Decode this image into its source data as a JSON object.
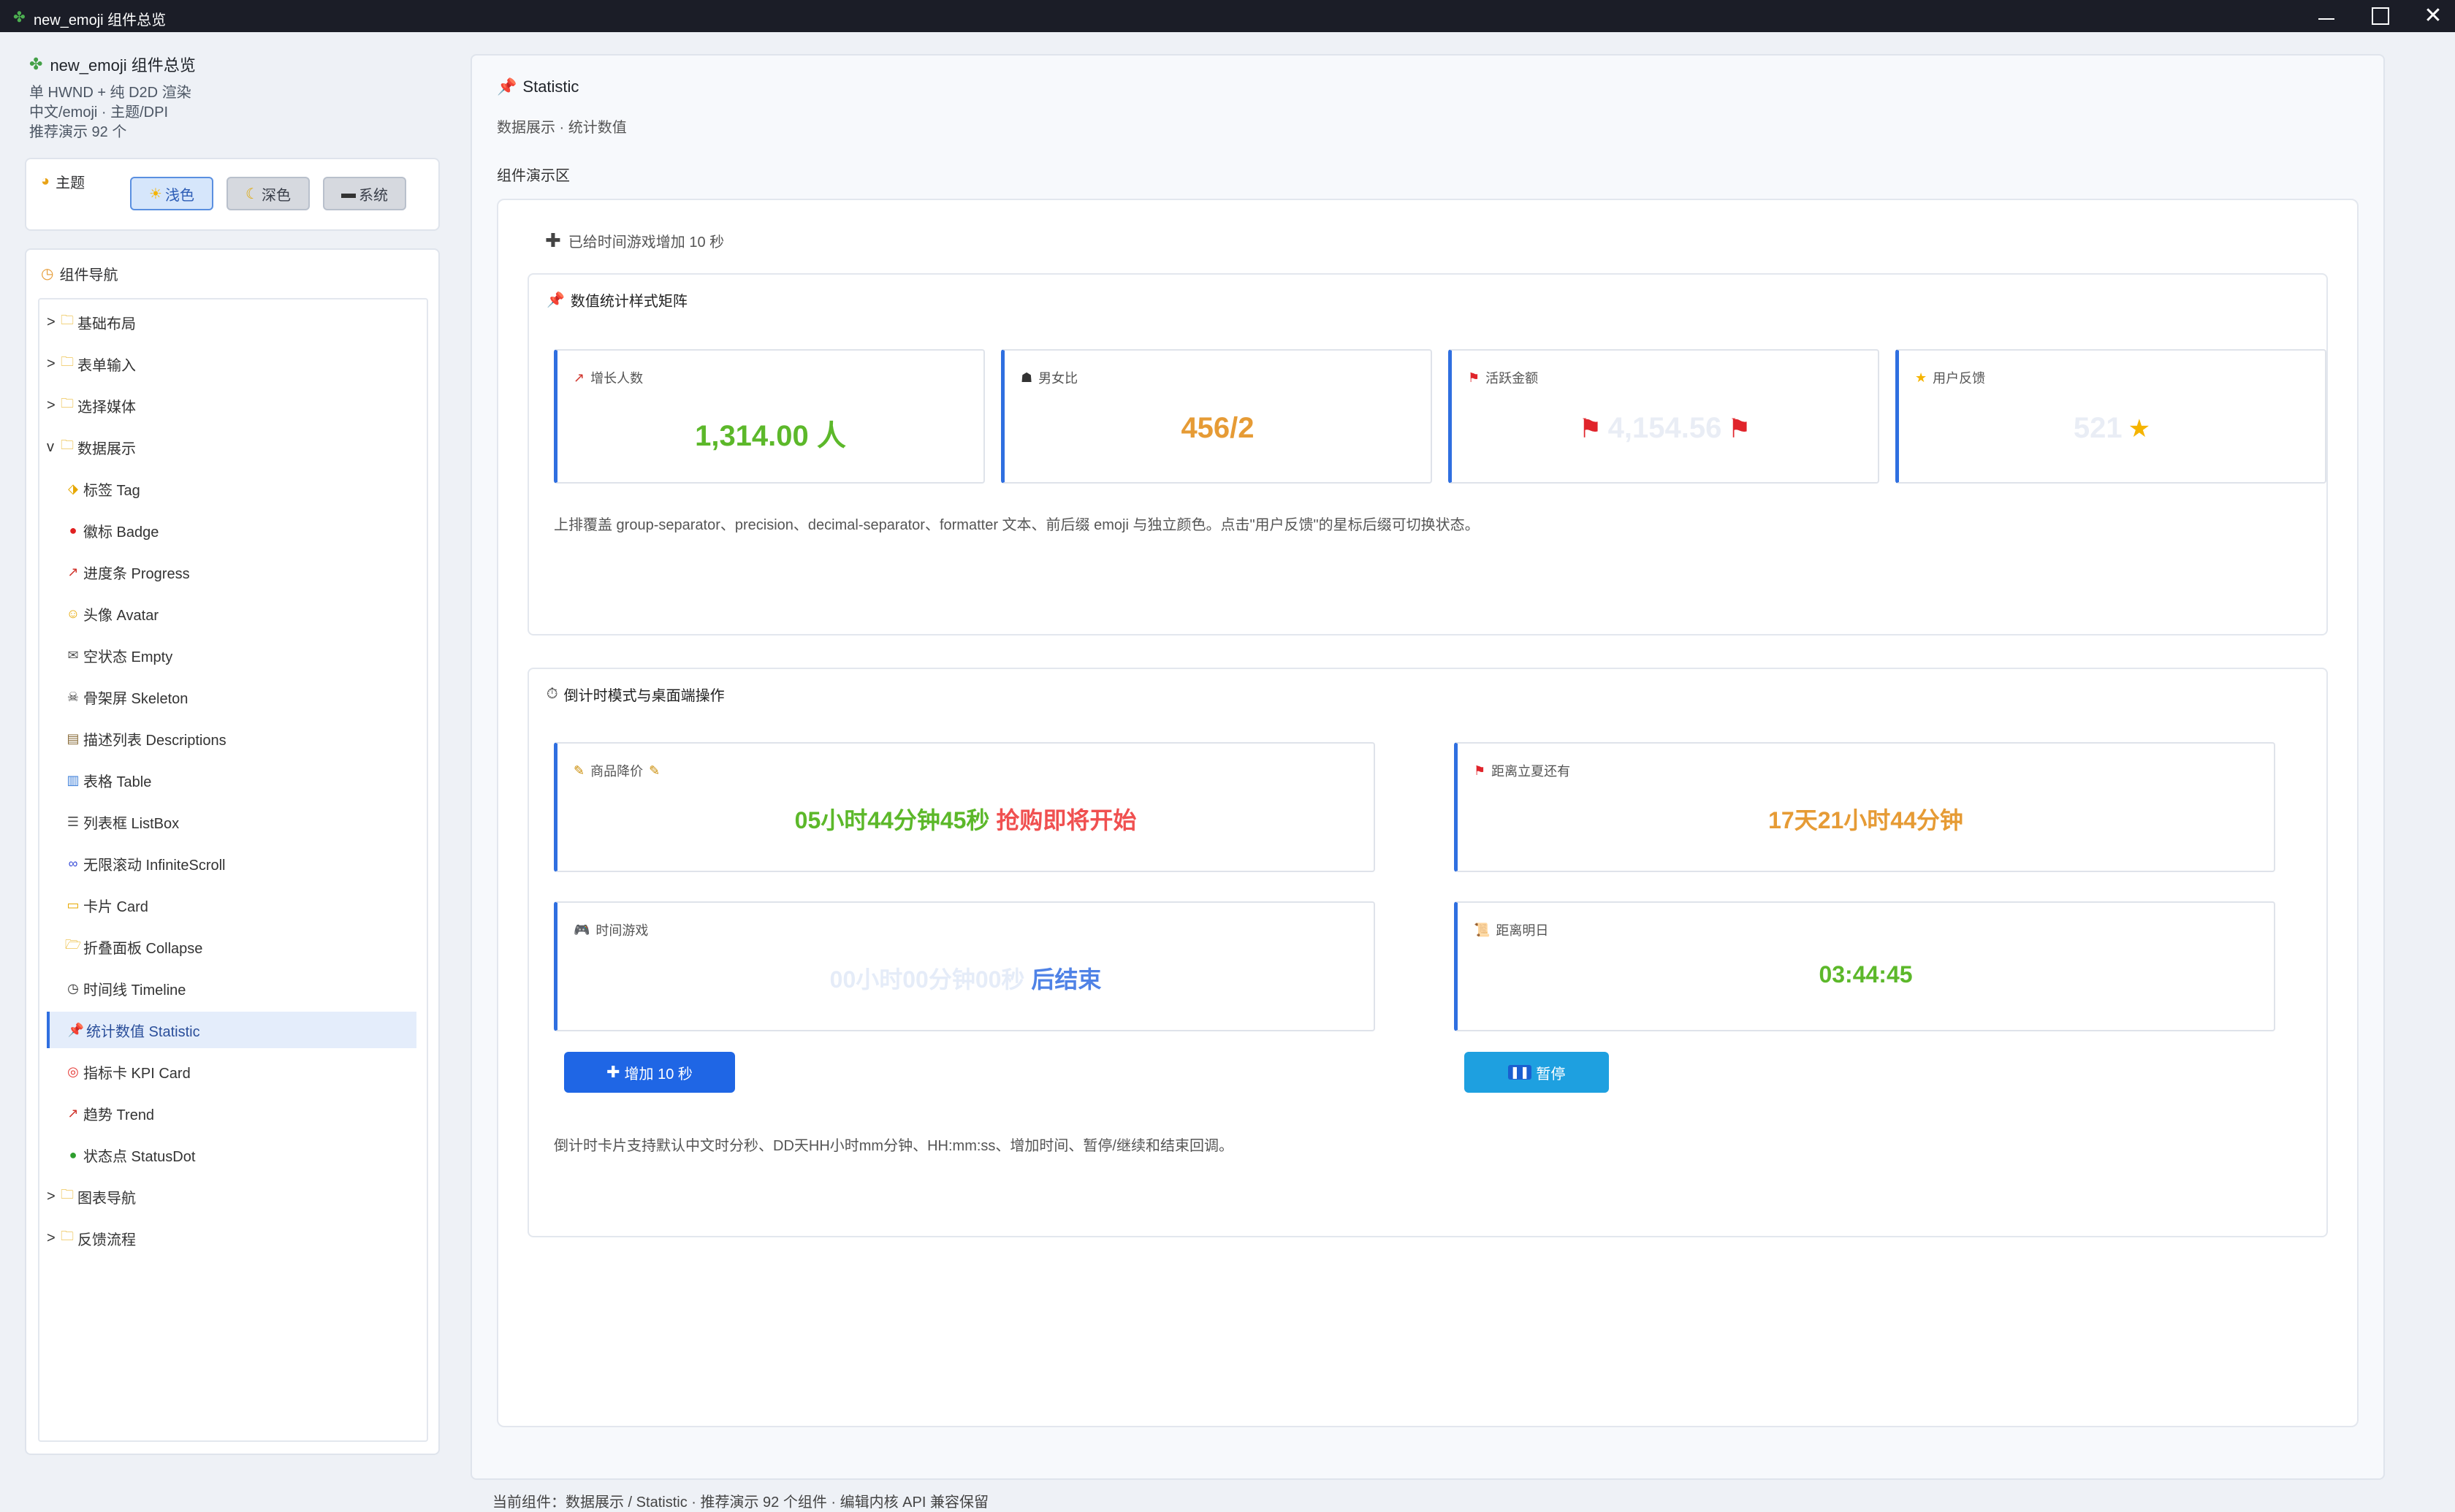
{
  "window": {
    "title": "new_emoji 组件总览",
    "app_icon": "clover-icon"
  },
  "sidebar": {
    "app_name": "new_emoji 组件总览",
    "info_lines": [
      "单 HWND + 纯 D2D 渲染",
      "中文/emoji · 主题/DPI",
      "推荐演示 92 个"
    ],
    "theme": {
      "label": "主题",
      "buttons": [
        {
          "label": "浅色",
          "icon": "sun-icon",
          "active": true
        },
        {
          "label": "深色",
          "icon": "moon-icon",
          "active": false
        },
        {
          "label": "系统",
          "icon": "laptop-icon",
          "active": false
        }
      ]
    },
    "nav": {
      "label": "组件导航",
      "items": [
        {
          "label": "基础布局",
          "arrow": ">",
          "icon": "folder-icon",
          "level": 0
        },
        {
          "label": "表单输入",
          "arrow": ">",
          "icon": "folder-icon",
          "level": 0
        },
        {
          "label": "选择媒体",
          "arrow": ">",
          "icon": "folder-icon",
          "level": 0
        },
        {
          "label": "数据展示",
          "arrow": "v",
          "icon": "folder-icon",
          "level": 0
        },
        {
          "label": "标签 Tag",
          "icon": "label-icon",
          "level": 1
        },
        {
          "label": "徽标 Badge",
          "icon": "red-circle-icon",
          "level": 1
        },
        {
          "label": "进度条 Progress",
          "icon": "chart-up-icon",
          "level": 1
        },
        {
          "label": "头像 Avatar",
          "icon": "smiley-icon",
          "level": 1
        },
        {
          "label": "空状态 Empty",
          "icon": "mailbox-icon",
          "level": 1
        },
        {
          "label": "骨架屏 Skeleton",
          "icon": "skull-icon",
          "level": 1
        },
        {
          "label": "描述列表 Descriptions",
          "icon": "clipboard-icon",
          "level": 1
        },
        {
          "label": "表格 Table",
          "icon": "bar-chart-icon",
          "level": 1
        },
        {
          "label": "列表框 ListBox",
          "icon": "list-icon",
          "level": 1
        },
        {
          "label": "无限滚动 InfiniteScroll",
          "icon": "infinity-icon",
          "level": 1
        },
        {
          "label": "卡片 Card",
          "icon": "card-icon",
          "level": 1
        },
        {
          "label": "折叠面板 Collapse",
          "icon": "open-folder-icon",
          "level": 1
        },
        {
          "label": "时间线 Timeline",
          "icon": "clock-icon",
          "level": 1
        },
        {
          "label": "统计数值 Statistic",
          "icon": "pushpin-icon",
          "level": 1,
          "selected": true
        },
        {
          "label": "指标卡 KPI Card",
          "icon": "target-icon",
          "level": 1
        },
        {
          "label": "趋势 Trend",
          "icon": "chart-up-icon",
          "level": 1
        },
        {
          "label": "状态点 StatusDot",
          "icon": "green-circle-icon",
          "level": 1
        },
        {
          "label": "图表导航",
          "arrow": ">",
          "icon": "folder-icon",
          "level": 0
        },
        {
          "label": "反馈流程",
          "arrow": ">",
          "icon": "folder-icon",
          "level": 0
        }
      ]
    }
  },
  "main": {
    "title": "Statistic",
    "title_icon": "pushpin-icon",
    "subtitle": "数据展示 · 统计数值",
    "demo_label": "组件演示区",
    "tip": "已给时间游戏增加 10 秒",
    "section1": {
      "title": "数值统计样式矩阵",
      "cards": [
        {
          "label": "增长人数",
          "icon": "chart-up-icon",
          "value": "1,314.00 人",
          "color": "#5cb82a"
        },
        {
          "label": "男女比",
          "icon": "people-icon",
          "value": "456/2",
          "color": "#e69b35"
        },
        {
          "label": "活跃金额",
          "icon": "red-flag-icon",
          "value": "4,154.56",
          "color": "#e9edf5"
        },
        {
          "label": "用户反馈",
          "icon": "star-icon",
          "value": "521",
          "suffix": "★",
          "color": "#e9edf5"
        }
      ],
      "description": "上排覆盖 group-separator、precision、decimal-separator、formatter 文本、前后缀 emoji 与独立颜色。点击\"用户反馈\"的星标后缀可切换状态。"
    },
    "section2": {
      "title": "倒计时模式与桌面端操作",
      "cards": [
        {
          "label": "商品降价",
          "icon": "pencil-icon",
          "value": "05小时44分钟45秒",
          "suffix": "抢购即将开始"
        },
        {
          "label": "距离立夏还有",
          "icon": "red-flag-icon",
          "value": "17天21小时44分钟"
        },
        {
          "label": "时间游戏",
          "icon": "gamepad-icon",
          "value": "00小时00分钟00秒",
          "suffix": "后结束"
        },
        {
          "label": "距离明日",
          "icon": "scroll-icon",
          "value": "03:44:45"
        }
      ],
      "add_button": "增加 10 秒",
      "pause_button": "暂停",
      "description": "倒计时卡片支持默认中文时分秒、DD天HH小时mm分钟、HH:mm:ss、增加时间、暂停/继续和结束回调。"
    }
  },
  "footer": "当前组件：数据展示 / Statistic · 推荐演示 92 个组件 · 编辑内核 API 兼容保留"
}
